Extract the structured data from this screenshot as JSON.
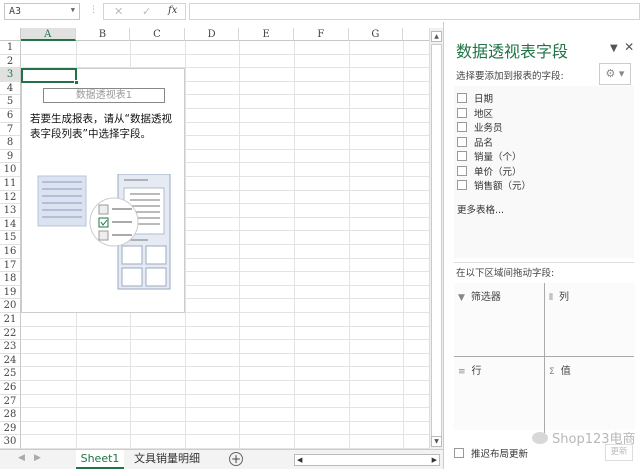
{
  "formula_bar": {
    "name_box": "A3",
    "cancel_icon": "✕",
    "enter_icon": "✓",
    "fx_label": "fx",
    "formula": ""
  },
  "columns": [
    "A",
    "B",
    "C",
    "D",
    "E",
    "F",
    "G"
  ],
  "rows": [
    "1",
    "2",
    "3",
    "4",
    "5",
    "6",
    "7",
    "8",
    "9",
    "10",
    "11",
    "12",
    "13",
    "14",
    "15",
    "16",
    "17",
    "18",
    "19",
    "20",
    "21",
    "22",
    "23",
    "24",
    "25",
    "26",
    "27",
    "28",
    "29",
    "30"
  ],
  "selected_cell": "A3",
  "pivot_placeholder": {
    "title": "数据透视表1",
    "message": "若要生成报表，请从“数据透视表字段列表”中选择字段。"
  },
  "sheet_tabs": [
    {
      "label": "Sheet1",
      "active": true
    },
    {
      "label": "文具销量明细",
      "active": false
    }
  ],
  "pane": {
    "title": "数据透视表字段",
    "subtitle": "选择要添加到报表的字段:",
    "fields": [
      "日期",
      "地区",
      "业务员",
      "品名",
      "销量（个）",
      "单价（元）",
      "销售额（元）"
    ],
    "more_tables": "更多表格...",
    "drag_label": "在以下区域间拖动字段:",
    "areas": {
      "filters": "筛选器",
      "columns": "列",
      "rows": "行",
      "values": "值"
    },
    "defer_label": "推迟布局更新",
    "update_button": "更新",
    "watermark": "Shop123电商"
  },
  "colors": {
    "accent": "#217346"
  }
}
